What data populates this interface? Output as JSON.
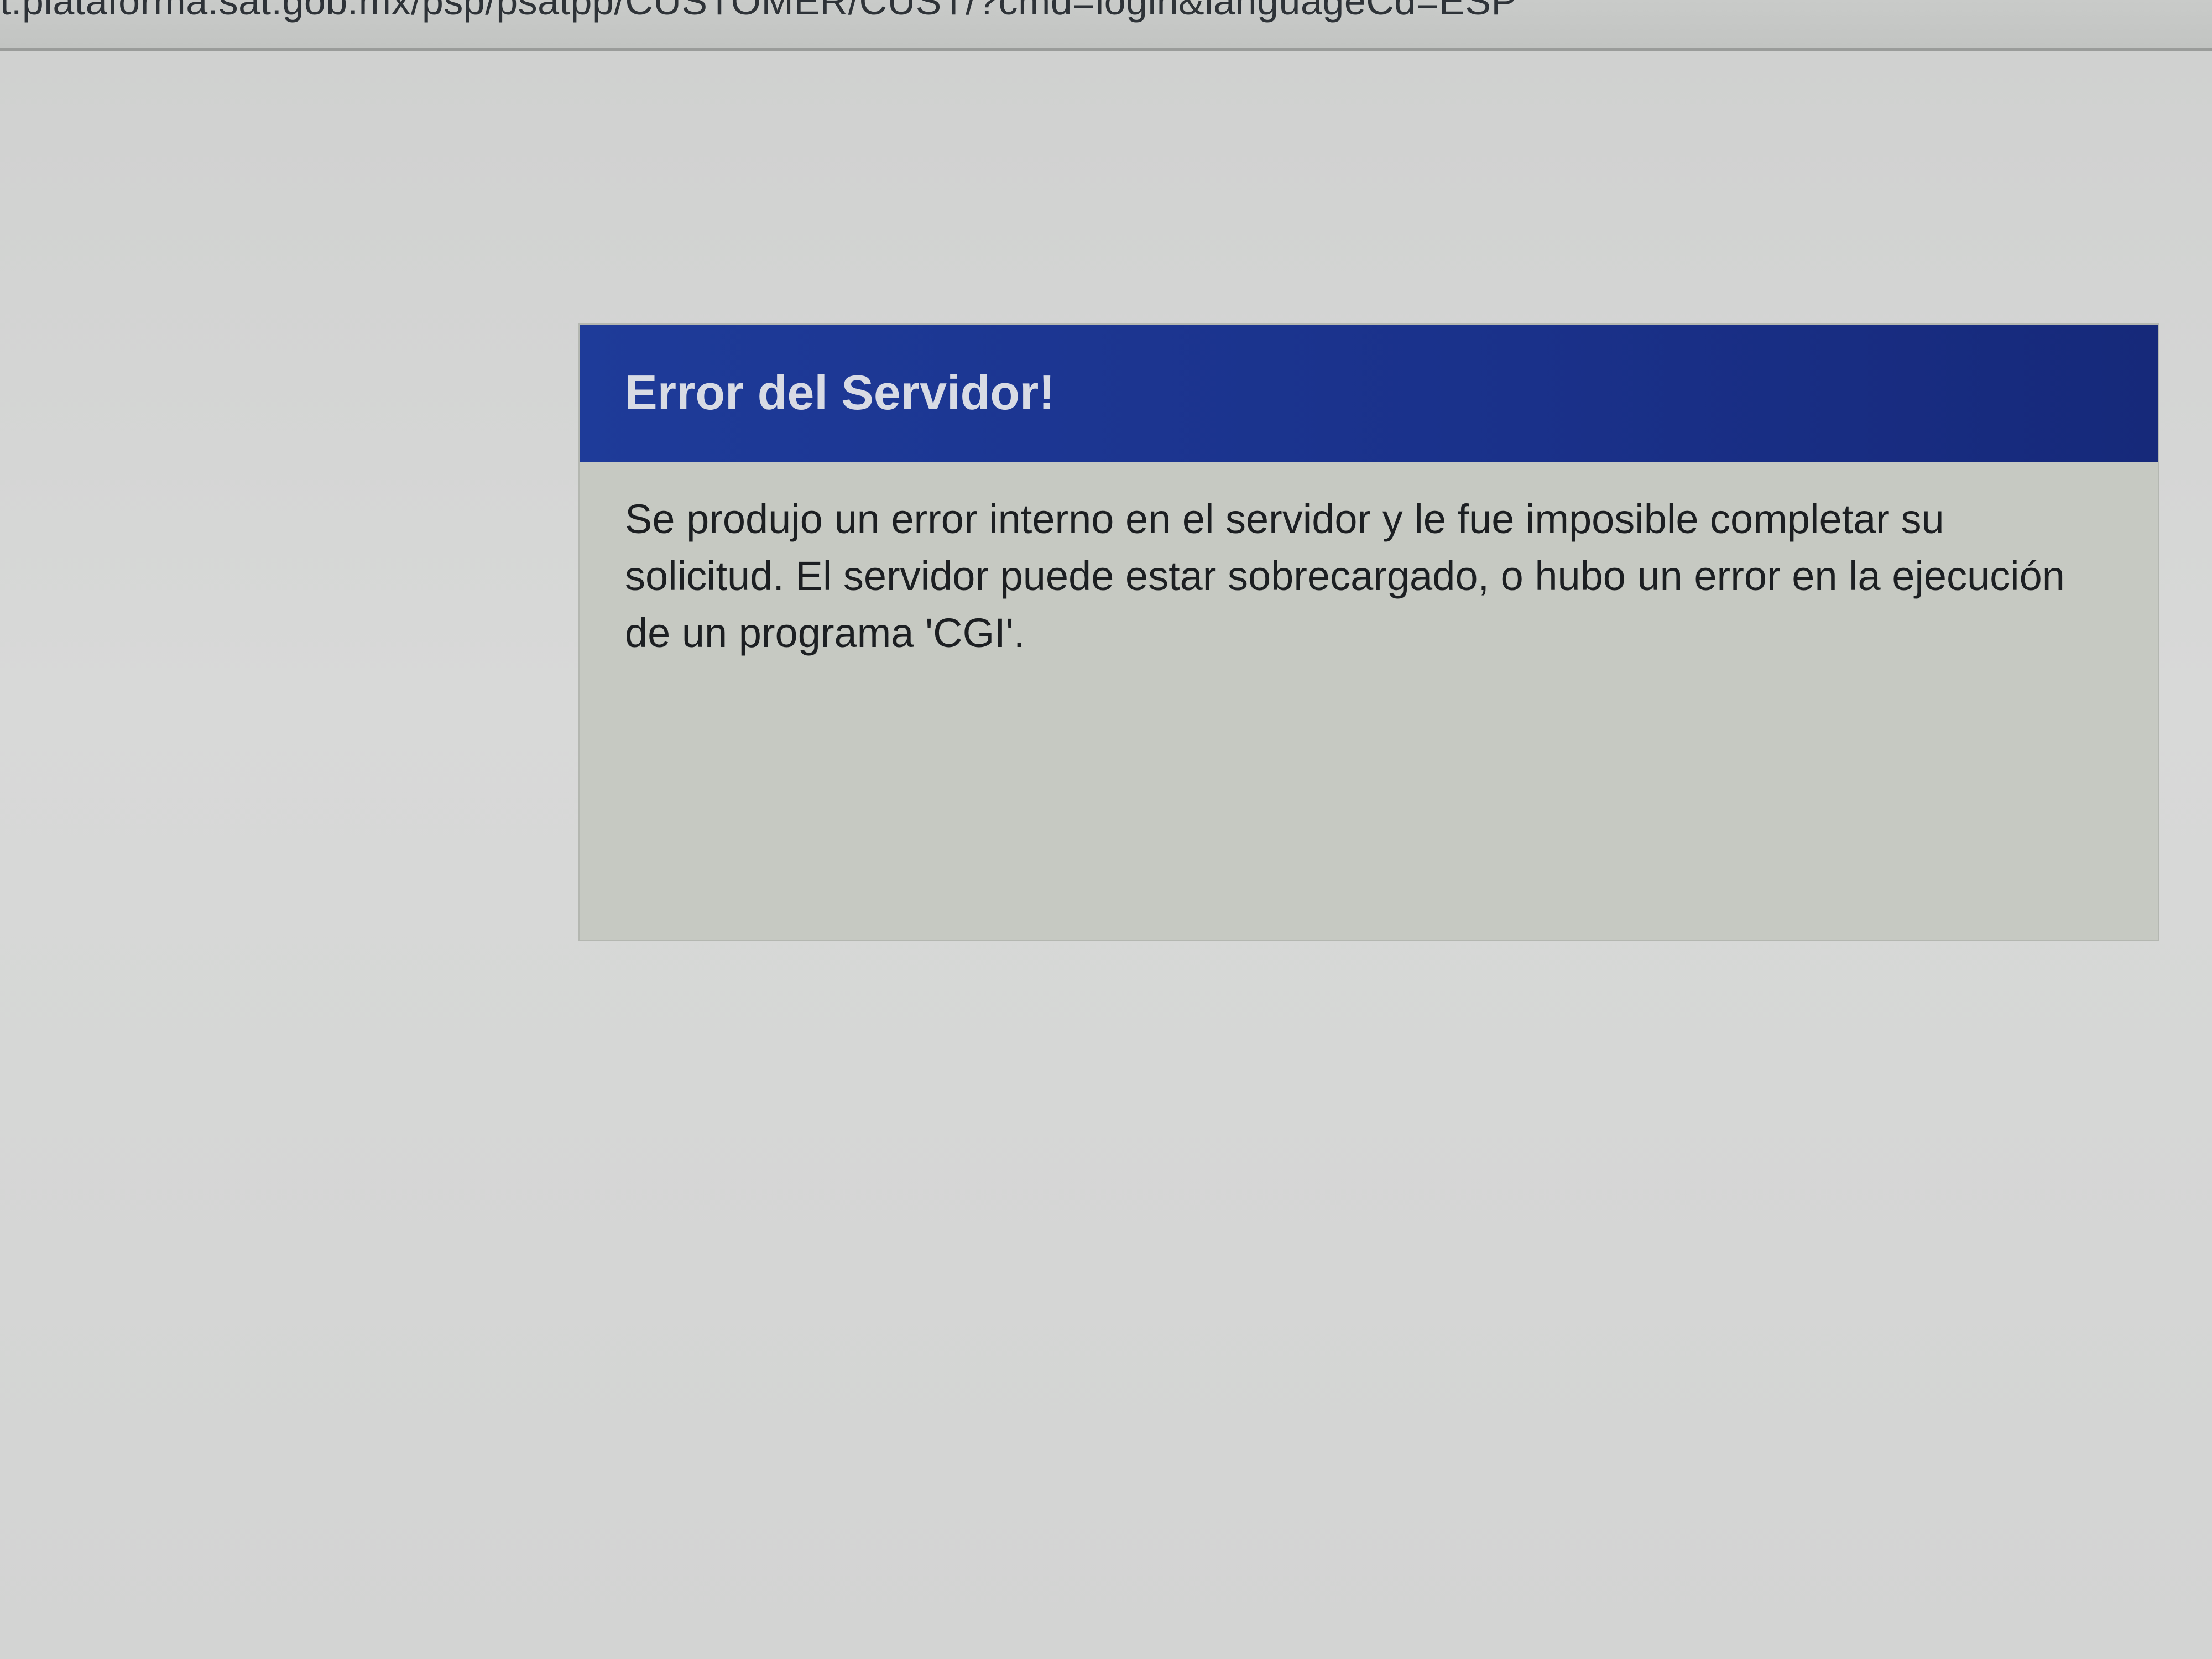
{
  "browser": {
    "url": "t.plataforma.sat.gob.mx/psp/psatpp/CUSTOMER/CUST/?cmd=login&languageCd=ESP"
  },
  "error": {
    "title": "Error del Servidor!",
    "message": "Se produjo un error interno en el servidor y le fue imposible completar su solicitud. El servidor puede estar sobrecargado, o hubo un error en la ejecución de un programa 'CGI'."
  },
  "colors": {
    "header_background": "#1e3b99",
    "header_text": "#d8dbe4",
    "panel_background": "#c6c9c2",
    "page_background": "#d3d4d3"
  }
}
